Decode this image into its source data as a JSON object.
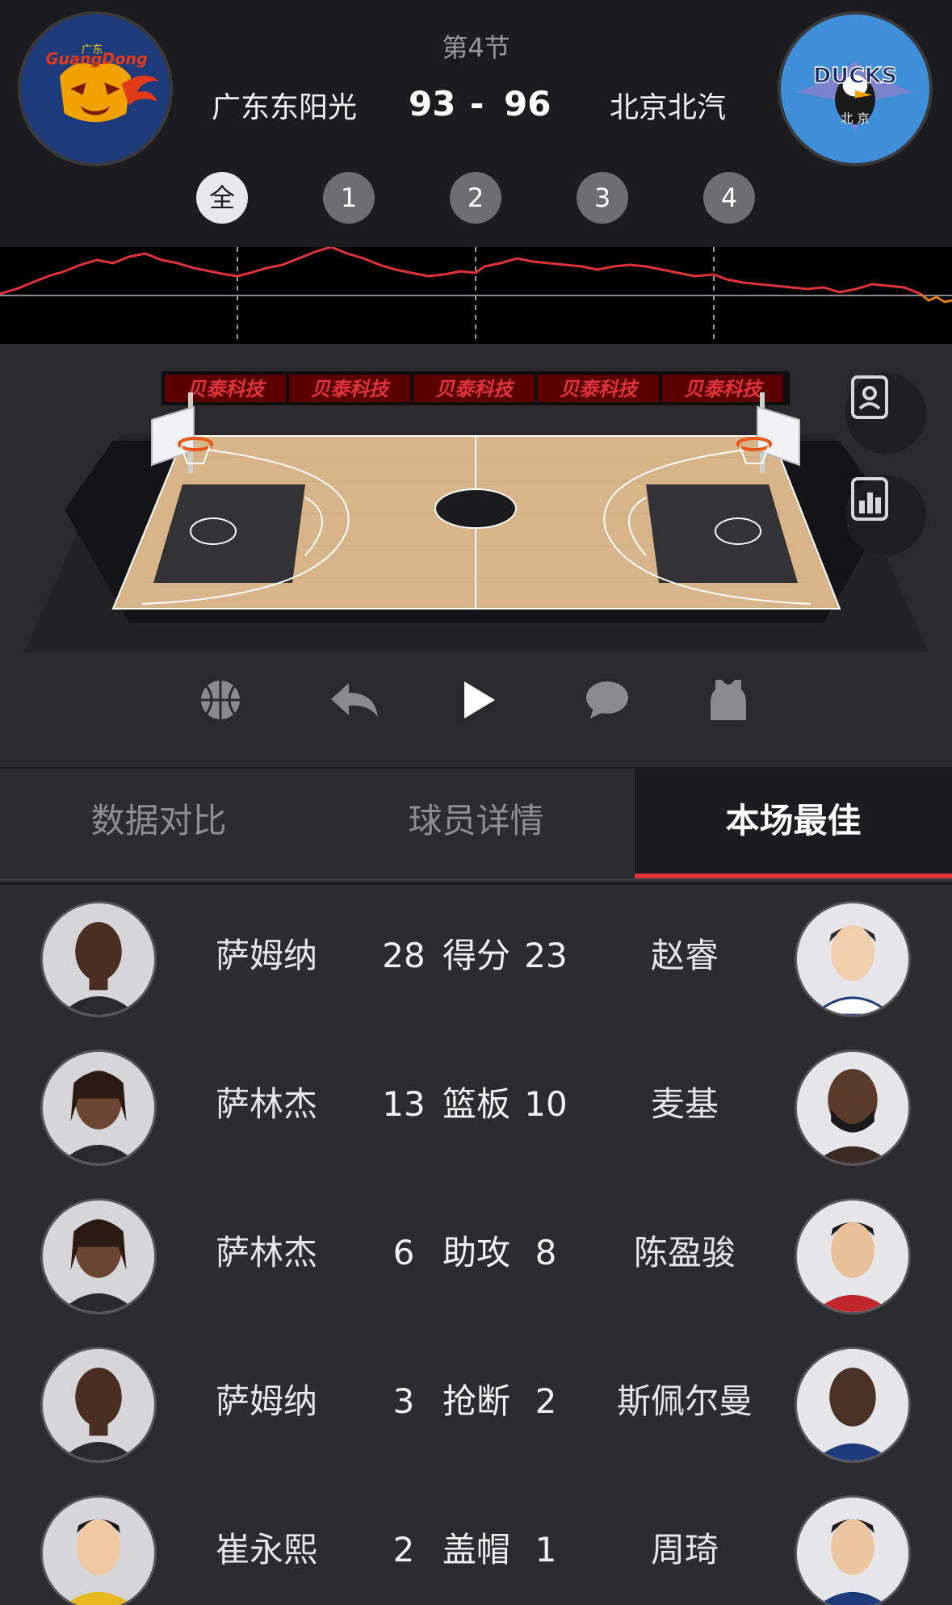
{
  "header": {
    "period": "第4节",
    "home": {
      "name": "广东东阳光",
      "score": "93",
      "logo_text": "GuangDong",
      "logo_sub": "广东"
    },
    "away": {
      "name": "北京北汽",
      "score": "96",
      "logo_text": "DUCKS",
      "logo_sub": "北 京"
    },
    "score_separator": "-"
  },
  "quarters": [
    "全",
    "1",
    "2",
    "3",
    "4"
  ],
  "active_quarter": "全",
  "court": {
    "banner": [
      "贝泰科技",
      "贝泰科技",
      "贝泰科技",
      "贝泰科技",
      "贝泰科技"
    ]
  },
  "side_buttons": [
    {
      "icon": "player-card-icon"
    },
    {
      "icon": "bar-chart-icon"
    }
  ],
  "controls": [
    {
      "icon": "basketball-icon"
    },
    {
      "icon": "back-arrow-icon"
    },
    {
      "icon": "play-icon"
    },
    {
      "icon": "comment-icon"
    },
    {
      "icon": "jersey-icon"
    }
  ],
  "tabs": [
    "数据对比",
    "球员详情",
    "本场最佳"
  ],
  "active_tab": "本场最佳",
  "accent_color": "#e0333a",
  "best_players": [
    {
      "home_name": "萨姆纳",
      "home_value": "28",
      "stat": "得分",
      "away_value": "23",
      "away_name": "赵睿"
    },
    {
      "home_name": "萨林杰",
      "home_value": "13",
      "stat": "篮板",
      "away_value": "10",
      "away_name": "麦基"
    },
    {
      "home_name": "萨林杰",
      "home_value": "6",
      "stat": "助攻",
      "away_value": "8",
      "away_name": "陈盈骏"
    },
    {
      "home_name": "萨姆纳",
      "home_value": "3",
      "stat": "抢断",
      "away_value": "2",
      "away_name": "斯佩尔曼"
    },
    {
      "home_name": "崔永熙",
      "home_value": "2",
      "stat": "盖帽",
      "away_value": "1",
      "away_name": "周琦"
    }
  ]
}
